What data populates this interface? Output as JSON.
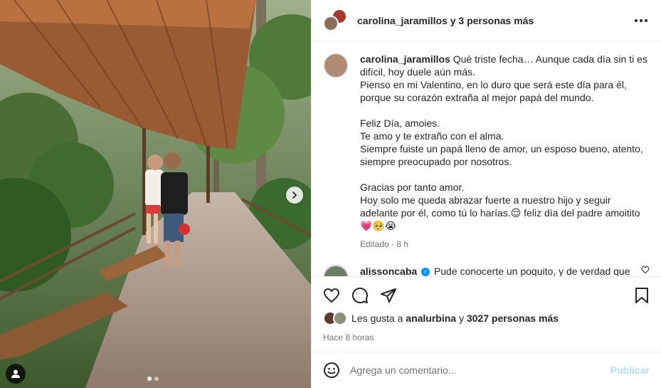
{
  "header": {
    "username": "carolina_jaramillos",
    "collab_text": "y 3 personas más"
  },
  "caption": {
    "username": "carolina_jaramillos",
    "lines": [
      "Qué triste fecha… Aunque cada día sin ti es",
      "difícil, hoy duele aún más.",
      "Pienso en mi Valentino, en lo duro que será este día para él,",
      "porque su corazón extraña al mejor papá del mundo.",
      "",
      "Feliz Día, amoies.",
      "Te amo y te extraño con el alma.",
      "Siempre fuiste un papá lleno de amor, un esposo bueno, atento,",
      "siempre preocupado por nosotros.",
      "",
      "Gracias por tanto amor.",
      "Hoy solo me queda abrazar fuerte a nuestro hijo y seguir",
      "adelante por él, como tú lo harías.😌  feliz día del padre amoitito",
      "💗🥺😭"
    ],
    "edited_label": "Editado",
    "edited_time": "8 h"
  },
  "comment": {
    "username": "alissoncaba",
    "text": "Pude conocerte un poquito, y de verdad que"
  },
  "likes": {
    "prefix": "Les gusta a",
    "user": "analurbina",
    "connector": "y",
    "others": "3027 personas más"
  },
  "time_ago": "Hace 8 horas",
  "composer": {
    "placeholder": "Agrega un comentario...",
    "publish_label": "Publicar"
  },
  "icons": {
    "more": "more-horizontal-icon",
    "like": "heart-icon",
    "comment": "comment-icon",
    "share": "share-icon",
    "save": "bookmark-icon",
    "emoji": "emoji-icon",
    "next": "chevron-right-icon",
    "tag": "user-tag-icon"
  },
  "colors": {
    "accent": "#0095f6",
    "publish_disabled": "#b2dffc",
    "muted": "#737373"
  },
  "carousel": {
    "slide_count": 2,
    "current_slide": 1
  }
}
